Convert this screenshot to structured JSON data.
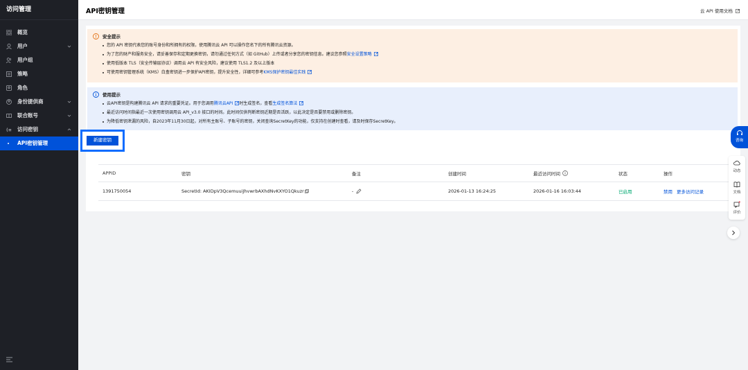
{
  "sidebar": {
    "title": "访问管理",
    "items": [
      {
        "label": "概览",
        "icon": "grid-icon"
      },
      {
        "label": "用户",
        "icon": "user-icon"
      },
      {
        "label": "用户组",
        "icon": "users-icon"
      },
      {
        "label": "策略",
        "icon": "policy-icon"
      },
      {
        "label": "角色",
        "icon": "role-icon"
      },
      {
        "label": "身份提供商",
        "icon": "identity-provider-icon"
      },
      {
        "label": "联合账号",
        "icon": "federation-icon"
      },
      {
        "label": "访问密钥",
        "icon": "key-icon"
      },
      {
        "label": "API密钥管理",
        "icon": "dot"
      }
    ]
  },
  "header": {
    "title": "API密钥管理",
    "doc_link": "云 API 使用文档"
  },
  "security_notice": {
    "title": "安全提示",
    "items": [
      {
        "text": "您的 API 密钥代表您的账号身份和所拥有的权限，使用腾讯云 API 可以操作您名下的所有腾讯云资源。",
        "link": ""
      },
      {
        "text": "为了您的财产和服务安全，请妥善保存和定期更换密钥，请勿通过任何方式（如 GitHub）上传或者分享您的密钥信息。建议您参照",
        "link": "安全设置策略"
      },
      {
        "text": "使用低版本 TLS（安全传输层协议）调用云 API 有安全风险，建议使用 TLS1.2 及以上版本",
        "link": ""
      },
      {
        "text": "可使用密钥管理系统（KMS）白盒密钥进一步保护API密钥，提升安全性，详细可参考",
        "link": "KMS保护密钥最佳实践"
      }
    ]
  },
  "usage_notice": {
    "title": "使用提示",
    "items": [
      {
        "text": "云API密钥是构建腾讯云 API 请求的重要凭证。用于您调用",
        "link": "腾讯云API",
        "text2": "时生成签名，查看",
        "link2": "生成签名算法"
      },
      {
        "text": "最近访问时间指最近一次使用密钥调用云 API_v3.0 接口的时间。此时间仅供判断密钥近期是否活跃，以此决定是否要禁用或删除密钥。"
      },
      {
        "text": "为降低密钥泄漏的风险，自2023年11月30日起，对所有主账号、子账号的密钥，关闭查询SecretKey的功能，仅支持在创建时查看，请及时保存SecretKey。"
      }
    ]
  },
  "new_key_button": "新建密钥",
  "table": {
    "columns": [
      "APPID",
      "密钥",
      "备注",
      "创建时间",
      "最近访问时间",
      "状态",
      "操作"
    ],
    "rows": [
      {
        "appid": "1391750054",
        "secret_id": "SecretId: AKIDpV3QcemuuiJhvwrbAXhdNvKXYO1Qkuzr",
        "remark": "-",
        "created": "2026-01-13 16:24:25",
        "last_access": "2026-01-16 16:03:44",
        "status": "已启用",
        "actions": [
          "禁用",
          "更多访问记录"
        ]
      }
    ]
  },
  "float_tools": {
    "main": "咨询",
    "items": [
      "动态",
      "文档",
      "评价"
    ]
  },
  "colors": {
    "primary": "#0052d9",
    "sidebar_bg": "#1e2026",
    "warn_bg": "#fdefe3",
    "info_bg": "#e8effc",
    "status_green": "#00a870"
  }
}
